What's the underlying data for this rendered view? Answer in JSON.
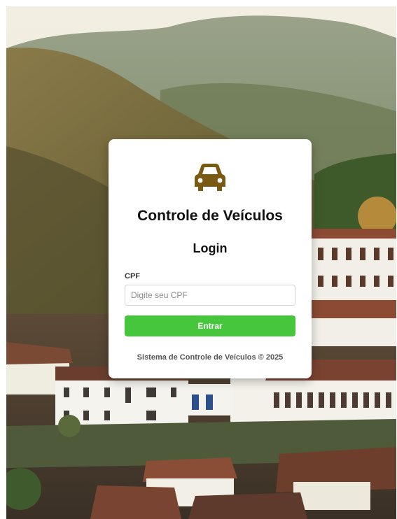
{
  "app": {
    "title": "Controle de Veículos",
    "logo_icon": "car-icon",
    "brand_color": "#7a5a12"
  },
  "login": {
    "heading": "Login",
    "cpf_label": "CPF",
    "cpf_placeholder": "Digite seu CPF",
    "cpf_value": "",
    "submit_label": "Entrar",
    "submit_color": "#45c63d"
  },
  "footer": {
    "text": "Sistema de Controle de Veículos © 2025"
  }
}
